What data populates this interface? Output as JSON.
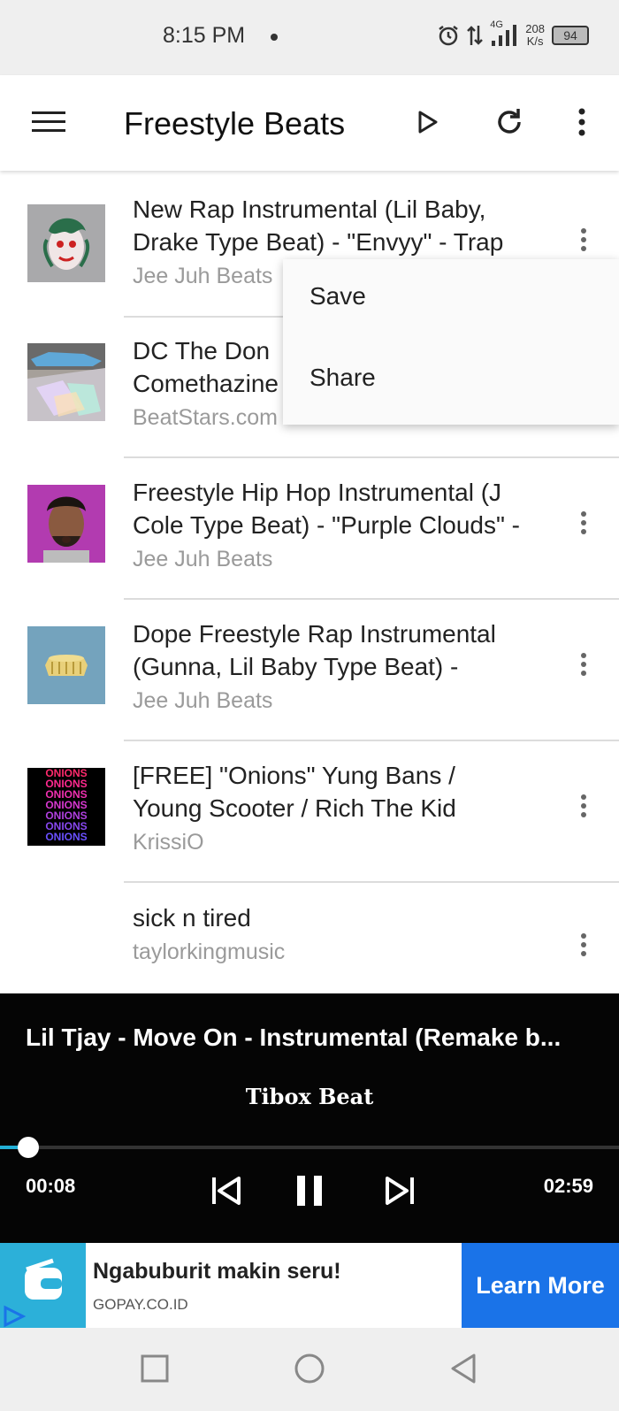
{
  "status_bar": {
    "time": "8:15 PM",
    "network": "4G",
    "speed_value": "208",
    "speed_unit": "K/s",
    "battery": "94"
  },
  "appbar": {
    "title": "Freestyle Beats"
  },
  "tracks": [
    {
      "title_line1": "New Rap Instrumental (Lil Baby,",
      "title_line2": "Drake Type Beat) - \"Envyy\" - Trap",
      "channel": "Jee Juh Beats"
    },
    {
      "title_line1": "DC The Don",
      "title_line2": "Comethazine",
      "channel": "BeatStars.com"
    },
    {
      "title_line1": "Freestyle Hip Hop Instrumental (J",
      "title_line2": "Cole Type Beat) - \"Purple Clouds\" -",
      "channel": "Jee Juh Beats"
    },
    {
      "title_line1": "Dope Freestyle Rap Instrumental",
      "title_line2": "(Gunna, Lil Baby Type Beat) -",
      "channel": "Jee Juh Beats"
    },
    {
      "title_line1": "[FREE] \"Onions\" Yung Bans /",
      "title_line2": "Young Scooter / Rich The Kid",
      "channel": "KrissiO"
    },
    {
      "title_line1": "sick n tired",
      "channel": "taylorkingmusic"
    }
  ],
  "thumb_texts": {
    "onions": "ONIONS"
  },
  "popup_menu": {
    "items": [
      "Save",
      "Share"
    ]
  },
  "player": {
    "title": "Lil Tjay - Move On - Instrumental (Remake b...",
    "artist": "Tibox Beat",
    "elapsed": "00:08",
    "duration": "02:59",
    "progress_fraction": 0.045
  },
  "ad": {
    "headline": "Ngabuburit makin seru!",
    "domain": "GOPAY.CO.ID",
    "cta": "Learn More"
  },
  "colors": {
    "accent": "#23b0d6",
    "ad_cta": "#1a73e8",
    "gopay": "#2cb0d9"
  }
}
